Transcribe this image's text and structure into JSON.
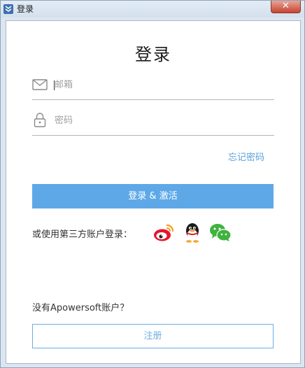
{
  "window": {
    "title": "登录",
    "close_glyph": "✕"
  },
  "form": {
    "heading": "登录",
    "email_placeholder": "邮箱",
    "password_placeholder": "密码",
    "forgot_link": "忘记密码",
    "login_button": "登录 & 激活",
    "third_party_label": "或使用第三方账户登录：",
    "third_party_icons": [
      "weibo-icon",
      "qq-icon",
      "wechat-icon"
    ],
    "no_account_text": "没有Apowersoft账户？",
    "register_button": "注册"
  },
  "colors": {
    "accent": "#5ea8e8",
    "link": "#5aa0dc",
    "close": "#c7432f"
  }
}
